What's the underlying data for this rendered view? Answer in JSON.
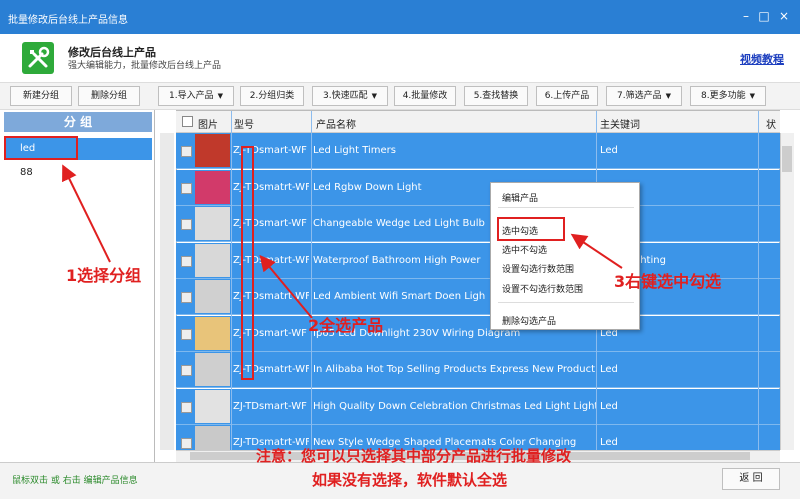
{
  "window": {
    "title": "批量修改后台线上产品信息",
    "minimize_icon": "minimize-icon",
    "maximize_icon": "maximize-icon",
    "close_icon": "close-icon"
  },
  "header": {
    "title": "修改后台线上产品",
    "subtitle": "强大编辑能力，批量修改后台线上产品",
    "video_link": "视频教程",
    "app_icon": "tools-wrench-screwdriver-icon"
  },
  "toolbar": {
    "new_group": "新建分组",
    "delete_group": "删除分组",
    "buttons": [
      {
        "label": "1.导入产品",
        "dropdown": true
      },
      {
        "label": "2.分组归类",
        "dropdown": false
      },
      {
        "label": "3.快速匹配",
        "dropdown": true
      },
      {
        "label": "4.批量修改",
        "dropdown": false
      },
      {
        "label": "5.查找替换",
        "dropdown": false
      },
      {
        "label": "6.上传产品",
        "dropdown": false
      },
      {
        "label": "7.筛选产品",
        "dropdown": true
      },
      {
        "label": "8.更多功能",
        "dropdown": true
      }
    ]
  },
  "groups": {
    "header": "分 组",
    "items": [
      {
        "label": "led",
        "selected": true
      },
      {
        "label": "88",
        "selected": false
      }
    ]
  },
  "table": {
    "columns": [
      "图片",
      "型号",
      "产品名称",
      "主关键词",
      "状态"
    ],
    "rows": [
      {
        "model": "ZJ-TDsmart-WF",
        "name": "Led Light Timers",
        "keyword": "Led",
        "thumb_color": "#c0392b"
      },
      {
        "model": "ZJ-TDsmatrt-WF",
        "name": "Led Rgbw Down Light",
        "keyword": "",
        "thumb_color": "#d23a6a"
      },
      {
        "model": "ZJ-TDsmart-WF",
        "name": "Changeable Wedge Led Light Bulb",
        "keyword": "",
        "thumb_color": "#dcdcdc"
      },
      {
        "model": "ZJ-TDsmatrt-WF",
        "name": "Waterproof Bathroom High Power",
        "keyword": "Bulb Lighting",
        "thumb_color": "#d8d8d8"
      },
      {
        "model": "ZJ-TDsmatrt-WF",
        "name": "Led Ambient Wifi Smart Doen Ligh",
        "keyword": "",
        "thumb_color": "#d0d0d0"
      },
      {
        "model": "ZJ-TDsmart-WF",
        "name": "Ip65 Led Downlight 230V Wiring Diagram",
        "keyword": "Led",
        "thumb_color": "#e8c47a"
      },
      {
        "model": "ZJ-TDsmatrt-WF",
        "name": "In Alibaba Hot Top Selling Products Express New Product",
        "keyword": "Led",
        "thumb_color": "#cfcfcf"
      },
      {
        "model": "ZJ-TDsmart-WF",
        "name": "High Quality Down Celebration Christmas Led Light Lights",
        "keyword": "Led",
        "thumb_color": "#e2e2e2"
      },
      {
        "model": "ZJ-TDsmatrt-WF",
        "name": "New Style Wedge Shaped Placemats Color Changing",
        "keyword": "Led",
        "thumb_color": "#c9c9c9"
      }
    ]
  },
  "context_menu": {
    "items": [
      {
        "label": "编辑产品",
        "sep_after": true
      },
      {
        "label": "选中勾选",
        "sep_after": false
      },
      {
        "label": "选中不勾选",
        "sep_after": false
      },
      {
        "label": "设置勾选行数范围",
        "sep_after": false
      },
      {
        "label": "设置不勾选行数范围",
        "sep_after": true
      },
      {
        "label": "删除勾选产品",
        "sep_after": false
      }
    ]
  },
  "annotations": {
    "step1": "1选择分组",
    "step2": "2全选产品",
    "step3": "3右键选中勾选",
    "note_line1": "注意：您可以只选择其中部分产品进行批量修改",
    "note_line2": "如果没有选择，软件默认全选",
    "color": "#e02020"
  },
  "status": {
    "hint": "鼠标双击 或 右击 编辑产品信息",
    "back_button": "返 回"
  },
  "colors": {
    "titlebar": "#2a7fd4",
    "selection": "#3c95e8",
    "group_header": "#7ea9da",
    "app_icon_bg": "#2eaa3a",
    "link": "#1d3fbf"
  }
}
